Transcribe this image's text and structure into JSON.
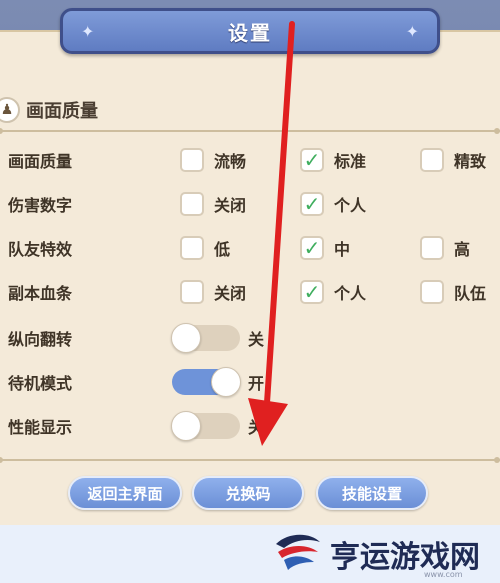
{
  "title": "设置",
  "section": {
    "title": "画面质量",
    "icon": "quality-icon"
  },
  "rows": [
    {
      "label": "画面质量",
      "options": [
        {
          "label": "流畅",
          "checked": false
        },
        {
          "label": "标准",
          "checked": true
        },
        {
          "label": "精致",
          "checked": false
        }
      ]
    },
    {
      "label": "伤害数字",
      "options": [
        {
          "label": "关闭",
          "checked": false
        },
        {
          "label": "个人",
          "checked": true
        }
      ]
    },
    {
      "label": "队友特效",
      "options": [
        {
          "label": "低",
          "checked": false
        },
        {
          "label": "中",
          "checked": true
        },
        {
          "label": "高",
          "checked": false
        }
      ]
    },
    {
      "label": "副本血条",
      "options": [
        {
          "label": "关闭",
          "checked": false
        },
        {
          "label": "个人",
          "checked": true
        },
        {
          "label": "队伍",
          "checked": false
        }
      ]
    }
  ],
  "toggles": [
    {
      "label": "纵向翻转",
      "state_label": "关",
      "on": false
    },
    {
      "label": "待机模式",
      "state_label": "开",
      "on": true
    },
    {
      "label": "性能显示",
      "state_label": "关",
      "on": false
    }
  ],
  "buttons": {
    "return": "返回主界面",
    "redeem": "兑换码",
    "skills": "技能设置"
  },
  "watermark": {
    "text": "亨运游戏网",
    "url": "www.com"
  },
  "colors": {
    "accent": "#6e93d9",
    "check": "#3fae5e",
    "panel": "#f4ead9",
    "arrow": "#e02020"
  }
}
